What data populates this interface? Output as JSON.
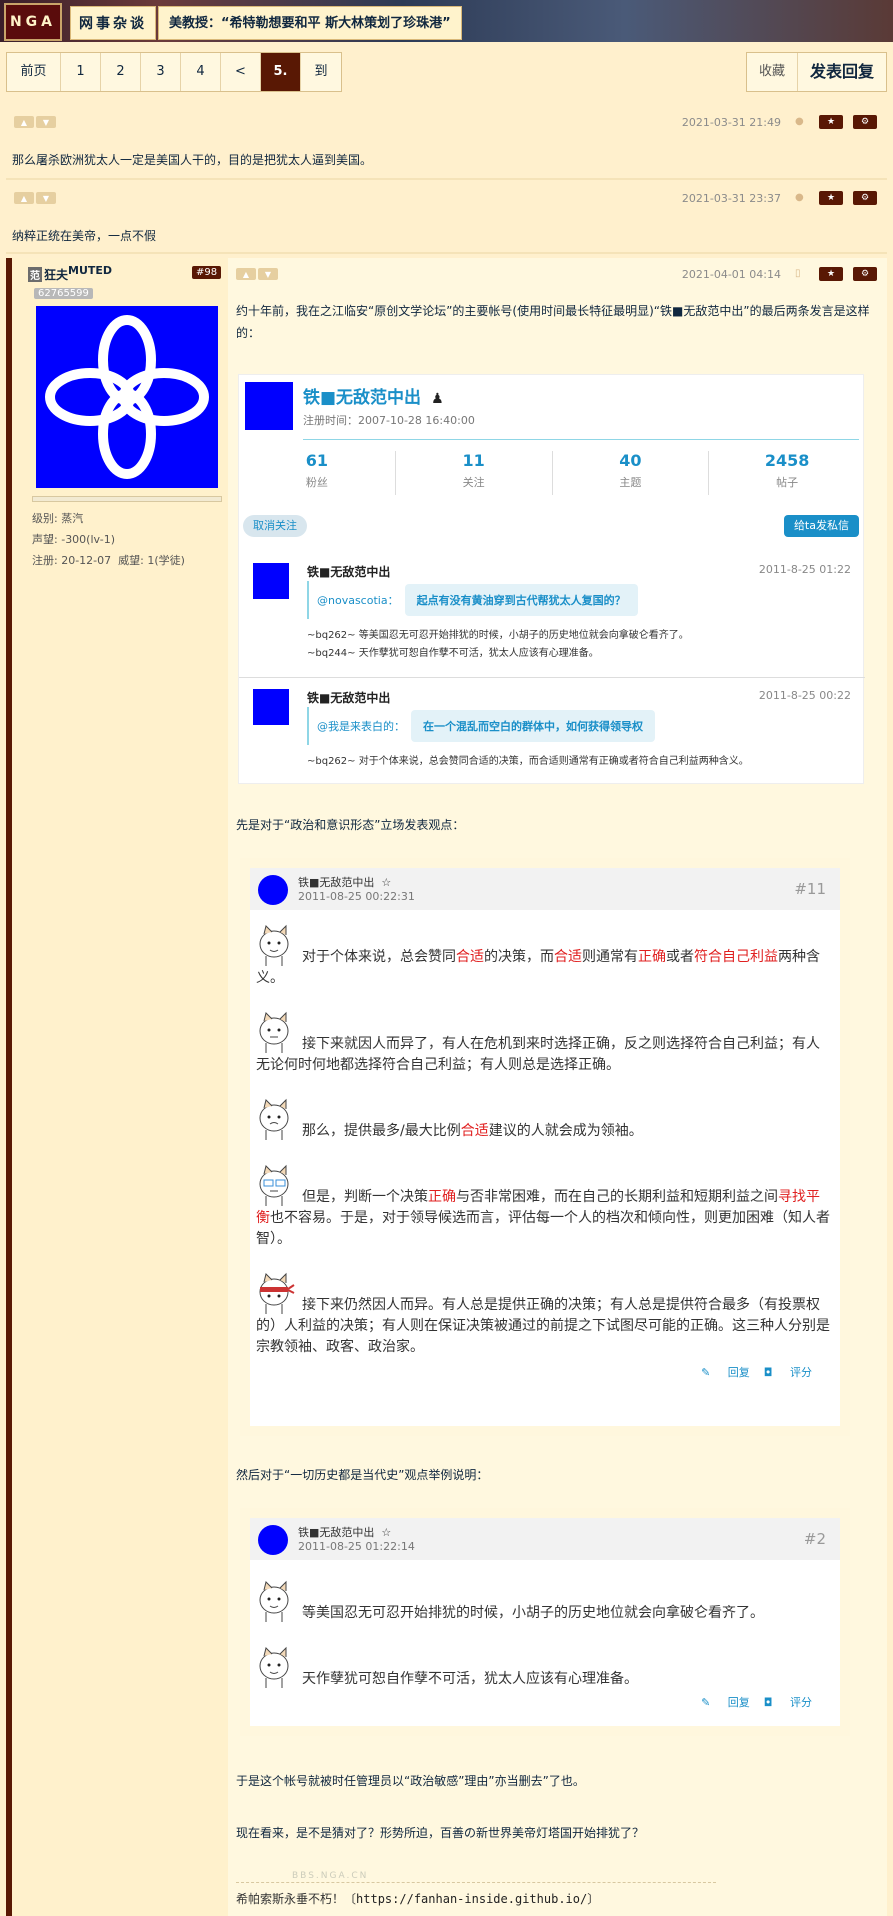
{
  "header": {
    "logo": "NGA",
    "forum": "网事杂谈",
    "title": "美教授：“希特勒想要和平 斯大林策划了珍珠港”"
  },
  "pager": {
    "first": "前页",
    "pages": [
      "1",
      "2",
      "3",
      "4"
    ],
    "prev": "<",
    "current": "5.",
    "goto": "到"
  },
  "actions": {
    "favorite": "收藏",
    "reply": "发表回复"
  },
  "replies": [
    {
      "time": "2021-03-31 21:49",
      "text": "那么屠杀欧洲犹太人一定是美国人干的，目的是把犹太人逼到美国。"
    },
    {
      "time": "2021-03-31 23:37",
      "text": "纳粹正统在美帝，一点不假"
    }
  ],
  "post": {
    "badge": "范",
    "author": "狂夫",
    "muted": "MUTED",
    "number": "#98",
    "uid": "62765599",
    "level_label": "级别:",
    "level": "蒸汽",
    "fame_label": "声望:",
    "fame": "-300(lv-1)",
    "reg_label": "注册:",
    "reg": "20-12-07",
    "power_label": "威望:",
    "power": "1(学徒)",
    "time": "2021-04-01 04:14",
    "intro": "约十年前，我在之江临安“原创文学论坛”的主要帐号(使用时间最长特征最明显)“铁■无敌范中出”的最后两条发言是这样的：",
    "card": {
      "name": "铁■无敌范中出",
      "reg": "注册时间：2007-10-28 16:40:00",
      "stats": [
        {
          "num": "61",
          "label": "粉丝"
        },
        {
          "num": "11",
          "label": "关注"
        },
        {
          "num": "40",
          "label": "主题"
        },
        {
          "num": "2458",
          "label": "帖子"
        }
      ],
      "unfollow": "取消关注",
      "pm": "给ta发私信",
      "messages": [
        {
          "name": "铁■无敌范中出",
          "time": "2011-8-25 01:22",
          "at": "@novascotia：",
          "quote": "起点有没有黄油穿到古代帮犹太人复国的？",
          "lines": [
            "~bq262~ 等美国忍无可忍开始排犹的时候，小胡子的历史地位就会向拿破仑看齐了。",
            "~bq244~ 天作孽犹可恕自作孽不可活，犹太人应该有心理准备。"
          ]
        },
        {
          "name": "铁■无敌范中出",
          "time": "2011-8-25 00:22",
          "at": "@我是来表白的：",
          "quote": "在一个混乱而空白的群体中，如何获得领导权",
          "lines": [
            "~bq262~ 对于个体来说，总会赞同合适的决策，而合适则通常有正确或者符合自己利益两种含义。"
          ]
        }
      ]
    },
    "para1": "先是对于“政治和意识形态”立场发表观点：",
    "quote1": {
      "name": "铁■无敌范中出",
      "star": "☆",
      "time": "2011-08-25 00:22:31",
      "no": "#11",
      "p1a": "对于个体来说，总会赞同",
      "p1b": "合适",
      "p1c": "的决策，而",
      "p1d": "合适",
      "p1e": "则通常有",
      "p1f": "正确",
      "p1g": "或者",
      "p1h": "符合自己利益",
      "p1i": "两种含义。",
      "p2": "接下来就因人而异了，有人在危机到来时选择正确，反之则选择符合自己利益；有人无论何时何地都选择符合自己利益；有人则总是选择正确。",
      "p3a": "那么，提供最多/最大比例",
      "p3b": "合适",
      "p3c": "建议的人就会成为领袖。",
      "p4a": "但是，判断一个决策",
      "p4b": "正确",
      "p4c": "与否非常困难，而在自己的长期利益和短期利益之间",
      "p4d": "寻找平衡",
      "p4e": "也不容易。于是，对于领导候选而言，评估每一个人的档次和倾向性，则更加困难（知人者智）。",
      "p5": "接下来仍然因人而异。有人总是提供正确的决策；有人总是提供符合最多（有投票权的）人利益的决策；有人则在保证决策被通过的前提之下试图尽可能的正确。这三种人分别是宗教领袖、政客、政治家。",
      "reply": "回复",
      "rate": "评分"
    },
    "para2": "然后对于“一切历史都是当代史”观点举例说明：",
    "quote2": {
      "name": "铁■无敌范中出",
      "star": "☆",
      "time": "2011-08-25 01:22:14",
      "no": "#2",
      "p1": "等美国忍无可忍开始排犹的时候，小胡子的历史地位就会向拿破仑看齐了。",
      "p2": "天作孽犹可恕自作孽不可活，犹太人应该有心理准备。",
      "reply": "回复",
      "rate": "评分"
    },
    "para3": "于是这个帐号就被时任管理员以“政治敏感”理由”亦当删去”了也。",
    "para4": "现在看来，是不是猜对了？形势所迫，百善の新世界美帝灯塔国开始排犹了？",
    "watermark": "BBS.NGA.CN",
    "signature": "希帕索斯永垂不朽！",
    "sig_url": "https://fanhan-inside.github.io/"
  }
}
